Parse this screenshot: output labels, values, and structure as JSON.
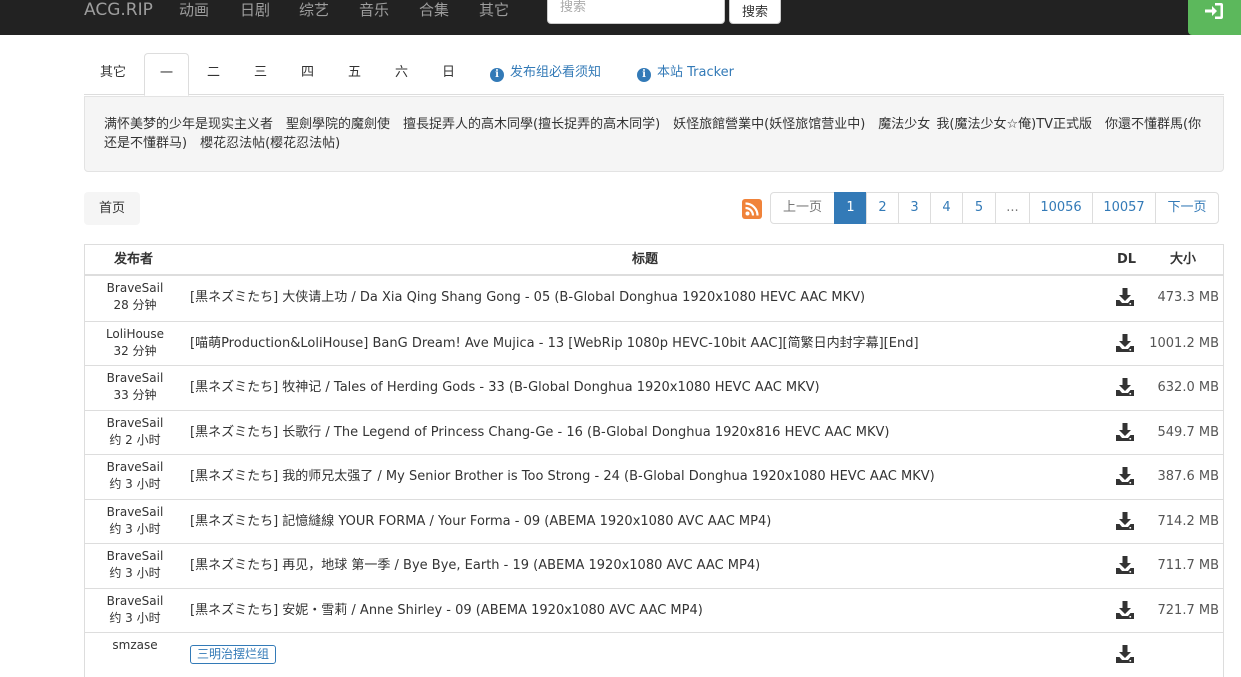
{
  "nav": {
    "brand": "ACG.RIP",
    "items": [
      "动画",
      "日剧",
      "综艺",
      "音乐",
      "合集",
      "其它"
    ],
    "search_placeholder": "搜索",
    "search_button": "搜索"
  },
  "tabs": {
    "days": [
      "其它",
      "一",
      "二",
      "三",
      "四",
      "五",
      "六",
      "日"
    ],
    "active": "一",
    "links": [
      "发布组必看须知",
      "本站 Tracker"
    ]
  },
  "bangumi_list": "满怀美梦的少年是现实主义者　聖劍學院的魔劍使　擅長捉弄人的高木同學(擅长捉弄的高木同学)　妖怪旅館營業中(妖怪旅馆营业中)　魔法少女 我(魔法少女☆俺)TV正式版　你還不懂群馬(你还是不懂群马)　櫻花忍法帖(樱花忍法帖)",
  "breadcrumb": {
    "home": "首页"
  },
  "pagination": [
    "上一页",
    "1",
    "2",
    "3",
    "4",
    "5",
    "...",
    "10056",
    "10057",
    "下一页"
  ],
  "table": {
    "headers": {
      "publisher": "发布者",
      "title": "标题",
      "dl": "DL",
      "size": "大小"
    },
    "rows": [
      {
        "publisher": "BraveSail",
        "time": "28 分钟",
        "title": "[黒ネズミたち] 大侠请上功 / Da Xia Qing Shang Gong - 05 (B-Global Donghua 1920x1080 HEVC AAC MKV)",
        "size": "473.3 MB"
      },
      {
        "publisher": "LoliHouse",
        "time": "32 分钟",
        "title": "[喵萌Production&LoliHouse] BanG Dream! Ave Mujica - 13 [WebRip 1080p HEVC-10bit AAC][简繁日内封字幕][End]",
        "size": "1001.2 MB"
      },
      {
        "publisher": "BraveSail",
        "time": "33 分钟",
        "title": "[黒ネズミたち] 牧神记 / Tales of Herding Gods - 33 (B-Global Donghua 1920x1080 HEVC AAC MKV)",
        "size": "632.0 MB"
      },
      {
        "publisher": "BraveSail",
        "time": "约 2 小时",
        "title": "[黒ネズミたち] 长歌行 / The Legend of Princess Chang-Ge - 16 (B-Global Donghua 1920x816 HEVC AAC MKV)",
        "size": "549.7 MB"
      },
      {
        "publisher": "BraveSail",
        "time": "约 3 小时",
        "title": "[黒ネズミたち] 我的师兄太强了 / My Senior Brother is Too Strong - 24 (B-Global Donghua 1920x1080 HEVC AAC MKV)",
        "size": "387.6 MB"
      },
      {
        "publisher": "BraveSail",
        "time": "约 3 小时",
        "title": "[黒ネズミたち] 記憶縫線 YOUR FORMA / Your Forma - 09 (ABEMA 1920x1080 AVC AAC MP4)",
        "size": "714.2 MB"
      },
      {
        "publisher": "BraveSail",
        "time": "约 3 小时",
        "title": "[黒ネズミたち] 再见，地球 第一季 / Bye Bye, Earth - 19 (ABEMA 1920x1080 AVC AAC MP4)",
        "size": "711.7 MB"
      },
      {
        "publisher": "BraveSail",
        "time": "约 3 小时",
        "title": "[黒ネズミたち] 安妮・雪莉 / Anne Shirley - 09 (ABEMA 1920x1080 AVC AAC MP4)",
        "size": "721.7 MB"
      },
      {
        "publisher": "smzase",
        "time": "",
        "badge": "三明治摆烂组",
        "title": "",
        "size": ""
      }
    ]
  },
  "colors": {
    "navbar": "#222222",
    "link": "#337ab7",
    "login": "#5cb85c",
    "rss": "#f0833a"
  },
  "icons": {
    "login": "sign-in-icon",
    "rss": "rss-icon",
    "info": "info-circle-icon",
    "download": "download-icon"
  }
}
